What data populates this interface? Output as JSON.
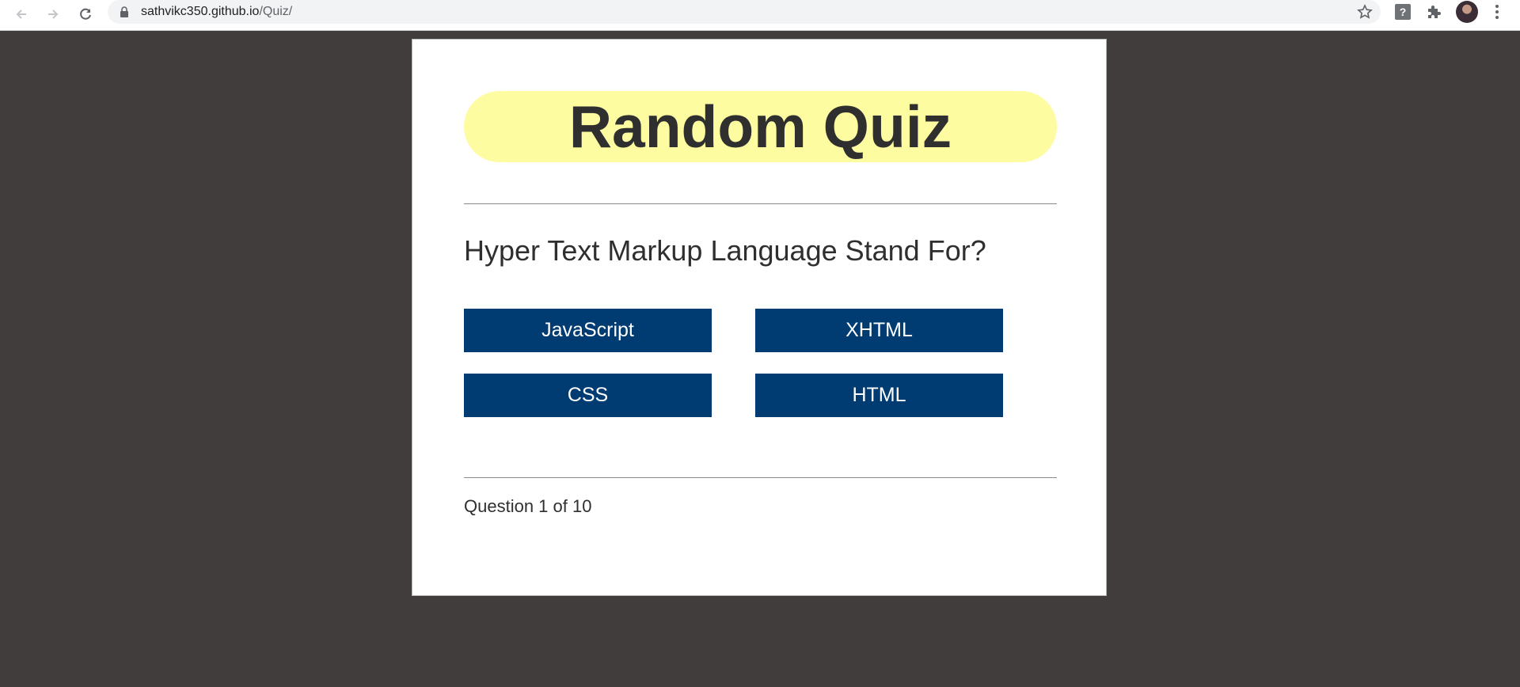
{
  "browser": {
    "url_host": "sathvikc350.github.io",
    "url_path": "/Quiz/",
    "icons": [
      "back-arrow-icon",
      "forward-arrow-icon",
      "reload-icon",
      "lock-icon",
      "star-icon",
      "extension-help-icon",
      "puzzle-icon",
      "avatar",
      "menu-dots-icon"
    ]
  },
  "quiz": {
    "title": "Random Quiz",
    "question": "Hyper Text Markup Language Stand For?",
    "choices": [
      "JavaScript",
      "XHTML",
      "CSS",
      "HTML"
    ],
    "progress": "Question 1 of 10"
  },
  "colors": {
    "background": "#413d3c",
    "title_bg": "#fdfca0",
    "button_bg": "#003c71",
    "text": "#2f2f2f"
  }
}
